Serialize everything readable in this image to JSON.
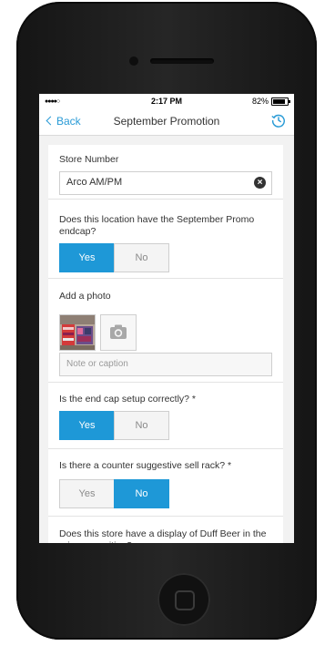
{
  "status_bar": {
    "signal": "●●●●○",
    "time": "2:17 PM",
    "battery": "82%"
  },
  "nav": {
    "back_label": "Back",
    "title": "September Promotion",
    "history_icon": "history-icon"
  },
  "form": {
    "store_number": {
      "label": "Store Number",
      "value": "Arco AM/PM"
    },
    "endcap_question": {
      "label": "Does this location have the September Promo endcap?",
      "yes": "Yes",
      "no": "No",
      "selected": "Yes"
    },
    "photo": {
      "label": "Add a photo",
      "caption_placeholder": "Note or caption"
    },
    "endcap_setup": {
      "label": "Is the end cap setup correctly? *",
      "yes": "Yes",
      "no": "No",
      "selected": "Yes"
    },
    "counter_rack": {
      "label": "Is there a counter suggestive sell rack? *",
      "yes": "Yes",
      "no": "No",
      "selected": "No"
    },
    "duff_display": {
      "label": "Does this store have a display of Duff Beer in the primary position?"
    }
  },
  "colors": {
    "accent": "#1e98d7",
    "link": "#2a9bd6"
  }
}
